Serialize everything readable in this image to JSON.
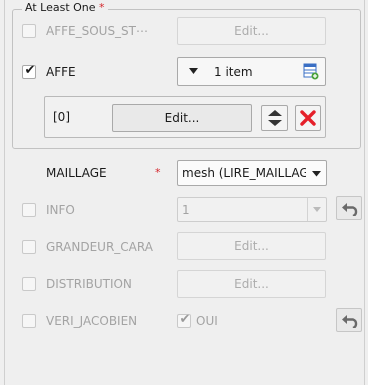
{
  "group": {
    "title": "At Least One",
    "required_star": "*"
  },
  "affe_sous_st": {
    "label": "AFFE_SOUS_ST⋯",
    "edit_label": "Edit..."
  },
  "affe": {
    "label": "AFFE",
    "checkmark": "✔",
    "count_label": "1 item",
    "item_index": "[0]",
    "item_edit_label": "Edit..."
  },
  "maillage": {
    "label": "MAILLAGE",
    "required_star": "*",
    "value": "mesh (LIRE_MAILLAGE"
  },
  "info": {
    "label": "INFO",
    "value": "1"
  },
  "grandeur_cara": {
    "label": "GRANDEUR_CARA",
    "edit_label": "Edit..."
  },
  "distribution": {
    "label": "DISTRIBUTION",
    "edit_label": "Edit..."
  },
  "veri_jacobien": {
    "label": "VERI_JACOBIEN",
    "oui_label": "OUI",
    "oui_checkmark": "✔"
  },
  "colors": {
    "required": "#d4252b",
    "delete": "#e5202a",
    "disabled_text": "#a3a3a3"
  },
  "icons": [
    "dropdown-arrow-icon",
    "table-add-icon",
    "move-up-down-icon",
    "delete-icon",
    "undo-icon"
  ]
}
